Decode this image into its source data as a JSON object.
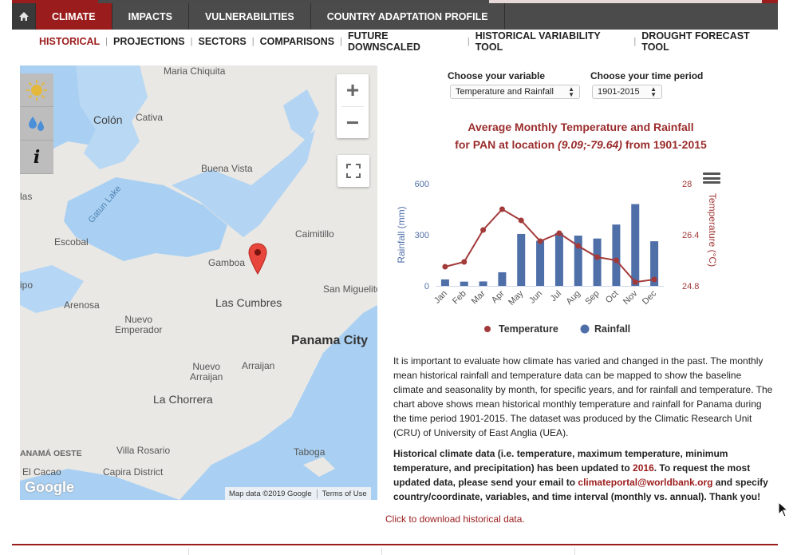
{
  "nav": {
    "tabs": [
      {
        "label": "CLIMATE"
      },
      {
        "label": "IMPACTS"
      },
      {
        "label": "VULNERABILITIES"
      },
      {
        "label": "COUNTRY ADAPTATION PROFILE"
      }
    ]
  },
  "subnav": {
    "items": [
      {
        "label": "HISTORICAL"
      },
      {
        "label": "PROJECTIONS"
      },
      {
        "label": "SECTORS"
      },
      {
        "label": "COMPARISONS"
      },
      {
        "label": "FUTURE DOWNSCALED"
      },
      {
        "label": "HISTORICAL VARIABILITY TOOL"
      },
      {
        "label": "DROUGHT FORECAST TOOL"
      }
    ]
  },
  "map": {
    "labels": {
      "maria_chiquita": "Maria Chiquita",
      "colon": "Colón",
      "cativa": "Cativa",
      "buena_vista": "Buena Vista",
      "gatun_lake": "Gatun Lake",
      "las": "las",
      "escobal": "Escobal",
      "caimitillo": "Caimitillo",
      "gamboa": "Gamboa",
      "ipo": "ipo",
      "san_miguelito": "San Miguelito",
      "las_cumbres": "Las Cumbres",
      "arenosa": "Arenosa",
      "nuevo_emperador": "Nuevo\nEmperador",
      "panama_city": "Panama City",
      "nuevo_arraijan": "Nuevo\nArraijan",
      "arraijan": "Arraijan",
      "la_chorrera": "La Chorrera",
      "panama_oeste": "ANAMÁ OESTE",
      "villa_rosario": "Villa Rosario",
      "taboga": "Taboga",
      "el_cacao": "El Cacao",
      "capira_district": "Capira District"
    },
    "google_logo": "Google",
    "attribution": "Map data ©2019 Google",
    "terms": "Terms of Use"
  },
  "selectors": {
    "variable": {
      "label": "Choose your variable",
      "value": "Temperature and Rainfall"
    },
    "period": {
      "label": "Choose your time period",
      "value": "1901-2015"
    }
  },
  "chart_title": {
    "line1": "Average Monthly Temperature and Rainfall",
    "line2_prefix": "for PAN at location ",
    "line2_location": "(9.09;-79.64)",
    "line2_suffix": " from 1901-2015"
  },
  "chart_data": {
    "type": "bar",
    "categories": [
      "Jan",
      "Feb",
      "Mar",
      "Apr",
      "May",
      "Jun",
      "Jul",
      "Aug",
      "Sep",
      "Oct",
      "Nov",
      "Dec"
    ],
    "series": [
      {
        "name": "Rainfall",
        "type": "bar",
        "axis": "left",
        "color": "#4f6fa8",
        "values": [
          38,
          25,
          26,
          80,
          305,
          265,
          310,
          295,
          278,
          360,
          480,
          262
        ]
      },
      {
        "name": "Temperature",
        "type": "line",
        "axis": "right",
        "color": "#a33a3a",
        "values": [
          25.4,
          25.55,
          26.55,
          27.2,
          26.85,
          26.2,
          26.45,
          26.05,
          25.7,
          25.6,
          24.92,
          25.0
        ]
      }
    ],
    "left_axis": {
      "label": "Rainfall (mm)",
      "min": 0,
      "max": 600,
      "ticks": [
        "0",
        "300",
        "600"
      ]
    },
    "right_axis": {
      "label": "Temperature (°C)",
      "min": 24.8,
      "max": 28,
      "ticks": [
        "24.8",
        "26.4",
        "28"
      ]
    },
    "legend": [
      "Temperature",
      "Rainfall"
    ]
  },
  "description": {
    "para1": "It is important to evaluate how climate has varied and changed in the past. The monthly mean historical rainfall and temperature data can be mapped to show the baseline climate and seasonality by month, for specific years, and for rainfall and temperature. The chart above shows mean historical monthly temperature and rainfall for Panama during the time period 1901-2015. The dataset was produced by the Climatic Research Unit (CRU) of University of East Anglia (UEA).",
    "para2_part1": "Historical climate data (i.e. temperature, maximum temperature, minimum temperature, and precipitation) has been updated to ",
    "para2_year": "2016",
    "para2_part2": ". To request the most updated data, please send your email to ",
    "para2_email": "climateportal@worldbank.org",
    "para2_part3": " and specify country/coordinate, variables, and time interval (monthly vs. annual). Thank you!"
  },
  "download_link": "Click to download historical data."
}
